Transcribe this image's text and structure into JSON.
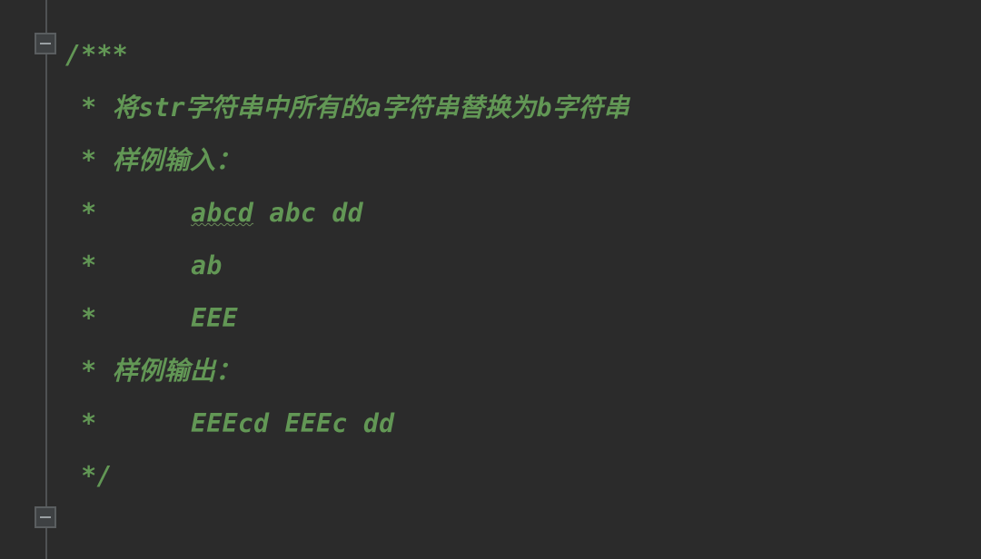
{
  "comment": {
    "open": "/***",
    "line1_prefix": " * ",
    "line1_a": "将",
    "line1_b": "str",
    "line1_c": "字符串中所有的",
    "line1_d": "a",
    "line1_e": "字符串替换为",
    "line1_f": "b",
    "line1_g": "字符串",
    "line2": " * 样例输入：",
    "line3_prefix": " *      ",
    "line3_typo": "abcd",
    "line3_rest": " abc dd",
    "line4": " *      ab",
    "line5": " *      EEE",
    "line6": " * 样例输出：",
    "line7": " *      EEEcd EEEc dd",
    "close": " */"
  },
  "fold": {
    "open_icon": "minus",
    "close_icon": "minus"
  }
}
